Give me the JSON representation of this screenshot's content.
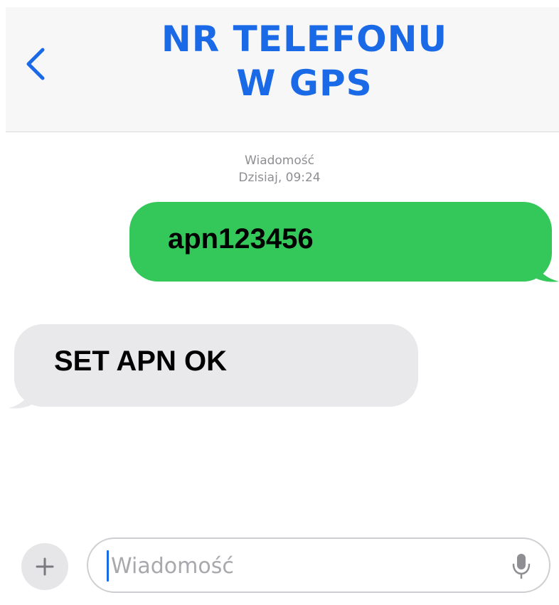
{
  "header": {
    "title_line1": "NR TELEFONU",
    "title_line2": "W GPS",
    "back_icon": "chevron-left-icon",
    "accent_color": "#1a6ae8"
  },
  "conversation": {
    "timestamp_label": "Wiadomość",
    "timestamp_time": "Dzisiaj, 09:24",
    "messages": [
      {
        "direction": "outgoing",
        "text": "apn123456",
        "color": "#34c759"
      },
      {
        "direction": "incoming",
        "text": "SET APN OK",
        "color": "#e9e9eb"
      }
    ]
  },
  "composer": {
    "plus_icon": "plus-icon",
    "placeholder": "Wiadomość",
    "value": "",
    "mic_icon": "microphone-icon"
  }
}
